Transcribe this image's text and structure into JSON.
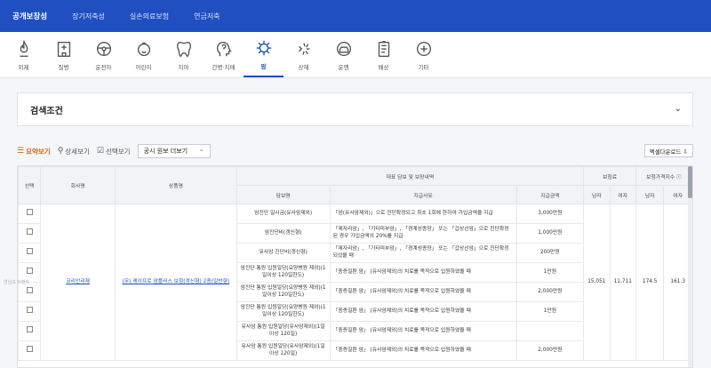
{
  "topnav": {
    "tabs": [
      {
        "label": "공개보장성",
        "active": true
      },
      {
        "label": "장기저축성",
        "active": false
      },
      {
        "label": "실손의료보험",
        "active": false
      },
      {
        "label": "연금저축",
        "active": false
      }
    ]
  },
  "categories": [
    {
      "label": "외제",
      "icon": "fire-icon"
    },
    {
      "label": "질병",
      "icon": "hospital-icon"
    },
    {
      "label": "운전자",
      "icon": "steering-wheel-icon"
    },
    {
      "label": "어린이",
      "icon": "child-face-icon"
    },
    {
      "label": "치아",
      "icon": "tooth-icon"
    },
    {
      "label": "간병·치매",
      "icon": "head-question-icon"
    },
    {
      "label": "암",
      "icon": "virus-icon"
    },
    {
      "label": "상해",
      "icon": "injury-icon"
    },
    {
      "label": "운행",
      "icon": "car-icon"
    },
    {
      "label": "배상",
      "icon": "document-icon"
    },
    {
      "label": "기타",
      "icon": "plus-circle-icon"
    }
  ],
  "active_category": 6,
  "search": {
    "title": "검색조건"
  },
  "toolbar": {
    "view_summary": "요약보기",
    "view_detail": "상세보기",
    "view_selected": "선택보기",
    "select_value": "공시 원보 더보기",
    "download": "엑셀다운로드 ⇩"
  },
  "table": {
    "headers": {
      "select": "선택",
      "company": "회사명",
      "product": "상품명",
      "coverage_group": "대표 담보 및 보장내역",
      "coverage_name": "담보명",
      "coverage_desc": "지급사유",
      "coverage_amount": "지급금액",
      "premium_group": "보험료",
      "premium_male": "남자",
      "premium_female": "여자",
      "index_group": "보험가격지수 ⓘ",
      "index_male": "남자",
      "index_female": "여자"
    },
    "company": "코리안리재",
    "product": "(무) 케이프로 암플러스 보험(갱신형) 2종(일반형)",
    "premium": {
      "male": "15,051",
      "female": "11,711"
    },
    "index": {
      "male": "174.5",
      "female": "161.3"
    },
    "rows": [
      {
        "name": "암진단 일시금(유사암제외)",
        "desc": "「암(유사암제외)」으로 진단확정되고 최초 1회에 한하여 가입금액을 지급",
        "amount": "3,000만원"
      },
      {
        "name": "암진단비(갱신형)",
        "desc": "「제자리암」, 「기타피부암」, 「경계성종양」 또는 「갑상선암」으로 진단확정된 경우 가입금액의 20%를 지급",
        "amount": "1,000만원"
      },
      {
        "name": "유사암 진단비(갱신형)",
        "desc": "「제자리암」, 「기타피부암」, 「경계성종양」 또는 「갑상선암」으로 진단확정되었을 때",
        "amount": "200만원"
      },
      {
        "name": "암진단 통원 입원일당(요양병원 제외)(1일이상 120일한도)",
        "desc": "「중증질환 암」 (유사암제외)의 치료를 목적으로 입원하였을 때",
        "amount": "1만원"
      },
      {
        "name": "암진단 통원 입원일당(요양병원 제외)(1일이상 120일한도)",
        "desc": "「중증질환 암」 (유사암제외)의 치료를 목적으로 입원하였을 때",
        "amount": "2,000만원"
      },
      {
        "name": "암진단 통원 입원일당(요양병원 제외)(1일이상 120일한도)",
        "desc": "「중증질환 암」 (유사암제외)의 치료를 목적으로 입원하였을 때",
        "amount": "1만원"
      },
      {
        "name": "유사암 통원 입원일당(유사암제외)(1일이상 120일)",
        "desc": "「중증질환 암」 (유사암제외)의 치료를 목적으로 입원하였을 때",
        "amount": ""
      },
      {
        "name": "유사암 통원 입원일당(유사암제외)(1일이상 120일)",
        "desc": "「중증질환 암」 (유사암제외)의 치료를 목적으로 입원하였을 때",
        "amount": "2,000만원"
      }
    ]
  },
  "side_hint": "연남요 이벤트"
}
